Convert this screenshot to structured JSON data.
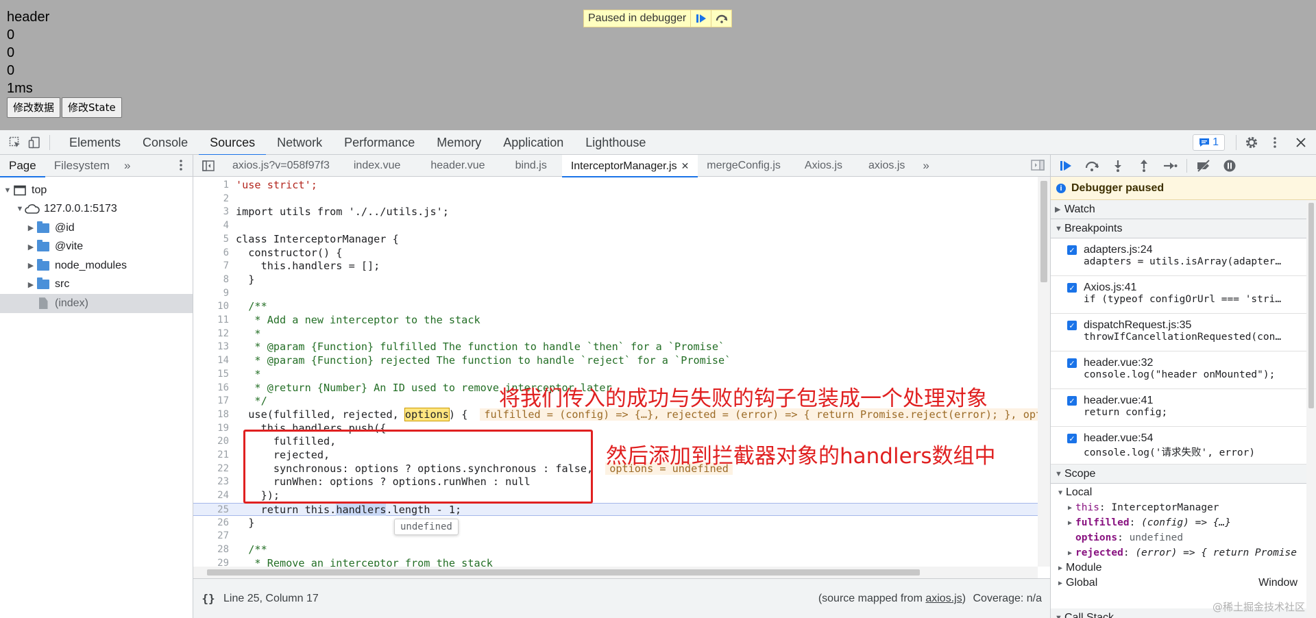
{
  "page": {
    "lines": [
      "header",
      "0",
      "0",
      "0",
      "1ms"
    ],
    "buttons": [
      "修改数据",
      "修改State"
    ],
    "paused_banner": "Paused in debugger"
  },
  "devtools": {
    "main_tabs": [
      "Elements",
      "Console",
      "Sources",
      "Network",
      "Performance",
      "Memory",
      "Application",
      "Lighthouse"
    ],
    "active_main_tab": "Sources",
    "issues_count": "1"
  },
  "navigator": {
    "tabs": [
      "Page",
      "Filesystem"
    ],
    "more": "»",
    "tree": [
      {
        "label": "top",
        "kind": "frame",
        "depth": 0,
        "expanded": true
      },
      {
        "label": "127.0.0.1:5173",
        "kind": "cloud",
        "depth": 1,
        "expanded": true
      },
      {
        "label": "@id",
        "kind": "folder",
        "depth": 2,
        "expanded": false
      },
      {
        "label": "@vite",
        "kind": "folder",
        "depth": 2,
        "expanded": false
      },
      {
        "label": "node_modules",
        "kind": "folder",
        "depth": 2,
        "expanded": false
      },
      {
        "label": "src",
        "kind": "folder",
        "depth": 2,
        "expanded": false
      },
      {
        "label": "(index)",
        "kind": "file",
        "depth": 2,
        "selected": true
      }
    ]
  },
  "editor": {
    "file_tabs": [
      "axios.js?v=058f97f3",
      "index.vue",
      "header.vue",
      "bind.js",
      "InterceptorManager.js",
      "mergeConfig.js",
      "Axios.js",
      "axios.js"
    ],
    "active_file_tab": "InterceptorManager.js",
    "more": "»",
    "code": [
      "'use strict';",
      "",
      "import utils from './../utils.js';",
      "",
      "class InterceptorManager {",
      "  constructor() {",
      "    this.handlers = [];",
      "  }",
      "",
      "  /**",
      "   * Add a new interceptor to the stack",
      "   *",
      "   * @param {Function} fulfilled The function to handle `then` for a `Promise`",
      "   * @param {Function} rejected The function to handle `reject` for a `Promise`",
      "   *",
      "   * @return {Number} An ID used to remove interceptor later",
      "   */",
      "  use(fulfilled, rejected, options) {",
      "    this.handlers.push({",
      "      fulfilled,",
      "      rejected,",
      "      synchronous: options ? options.synchronous : false,",
      "      runWhen: options ? options.runWhen : null",
      "    });",
      "    return this.handlers.length - 1;",
      "  }",
      "",
      "  /**",
      "   * Remove an interceptor from the stack"
    ],
    "inline_values": {
      "line18": "fulfilled = (config) => {…}, rejected = (error) => { return Promise.reject(error); }, opti",
      "line22": "options = undefined"
    },
    "tooltip": "undefined",
    "status": {
      "position": "Line 25, Column 17",
      "source_mapped_prefix": "(source mapped from ",
      "source_mapped_file": "axios.js",
      "source_mapped_suffix": ")",
      "coverage": "Coverage: n/a",
      "pretty_print": "{}"
    }
  },
  "annotations": {
    "first": "将我们传入的成功与失败的钩子包装成一个处理对象",
    "second": "然后添加到拦截器对象的handlers数组中"
  },
  "debugger": {
    "paused_label": "Debugger paused",
    "watch": "Watch",
    "breakpoints_label": "Breakpoints",
    "breakpoints": [
      {
        "file": "adapters.js:24",
        "code": "adapters = utils.isArray(adapter…"
      },
      {
        "file": "Axios.js:41",
        "code": "if (typeof configOrUrl === 'stri…"
      },
      {
        "file": "dispatchRequest.js:35",
        "code": "throwIfCancellationRequested(con…"
      },
      {
        "file": "header.vue:32",
        "code": "console.log(\"header onMounted\");"
      },
      {
        "file": "header.vue:41",
        "code": "return config;"
      },
      {
        "file": "header.vue:54",
        "code": "console.log('请求失败', error)"
      }
    ],
    "scope_label": "Scope",
    "local_label": "Local",
    "scope_vars": [
      {
        "key": "this",
        "value": "InterceptorManager",
        "expandable": true,
        "bold": false
      },
      {
        "key": "fulfilled",
        "value": "(config) => {…}",
        "expandable": true,
        "bold": true
      },
      {
        "key": "options",
        "value": "undefined",
        "expandable": false,
        "bold": true
      },
      {
        "key": "rejected",
        "value": "(error) => { return Promise",
        "expandable": true,
        "bold": true
      }
    ],
    "module_label": "Module",
    "global_label": "Global",
    "global_value": "Window",
    "call_stack_label": "Call Stack",
    "watermark": "@稀土掘金技术社区"
  },
  "colors": {
    "accent": "#1a73e8",
    "annotation_red": "#e02020",
    "exec_line": "#e8eefc",
    "page_bg": "#ababab"
  }
}
